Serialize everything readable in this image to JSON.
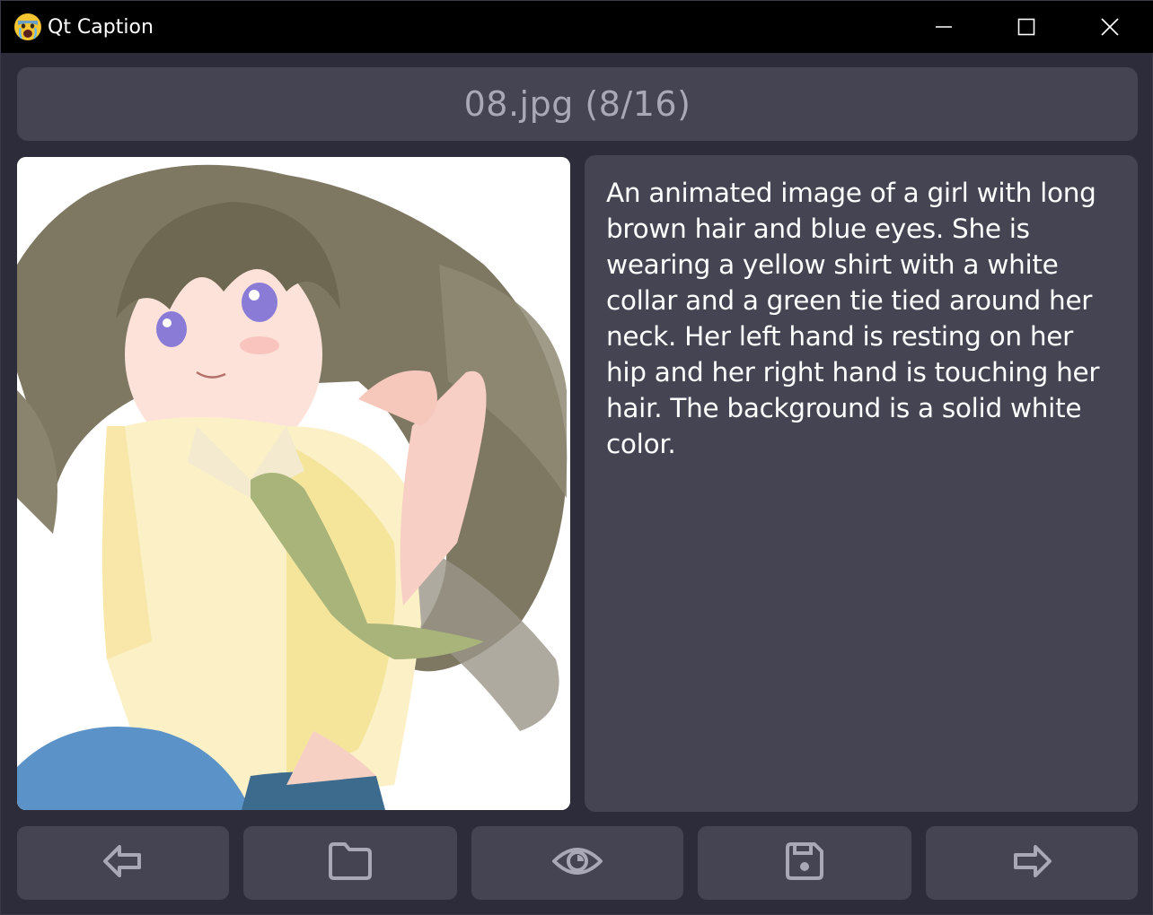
{
  "window": {
    "title": "Qt Caption",
    "app_icon": "crying-face-emoji-icon",
    "controls": [
      "minimize-icon",
      "maximize-icon",
      "close-icon"
    ]
  },
  "header": {
    "filename_counter": "08.jpg (8/16)"
  },
  "image": {
    "subject": "anime-girl-portrait"
  },
  "caption": {
    "text": "An animated image of a girl with long brown hair and blue eyes. She is wearing a yellow shirt with a white collar and a green tie tied around her neck. Her left hand is resting on her hip and her right hand is touching her hair. The background is a solid white color."
  },
  "toolbar": {
    "buttons": [
      {
        "icon": "arrow-left-icon"
      },
      {
        "icon": "folder-icon"
      },
      {
        "icon": "eye-icon"
      },
      {
        "icon": "save-icon"
      },
      {
        "icon": "arrow-right-icon"
      }
    ]
  },
  "colors": {
    "background": "#2c2c3a",
    "panel": "#444452",
    "titlebar": "#000000",
    "icon_stroke": "#a8a8b6",
    "header_text": "#a8a8b6",
    "caption_text": "#ffffff"
  }
}
